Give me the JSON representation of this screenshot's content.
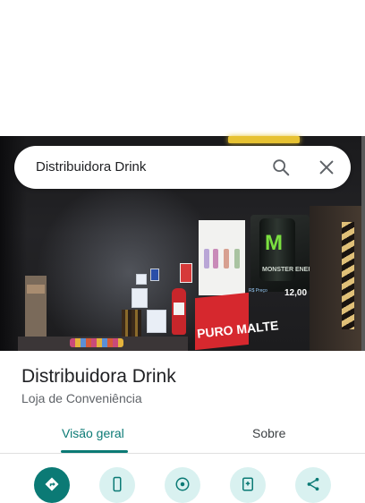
{
  "search": {
    "query": "Distribuidora Drink"
  },
  "place": {
    "name": "Distribuidora Drink",
    "category": "Loja de Conveniência"
  },
  "tabs": [
    {
      "label": "Visão geral",
      "active": true
    },
    {
      "label": "Sobre",
      "active": false
    }
  ],
  "photo_text": {
    "poster": "PURO MALTE",
    "monster": "MONSTER ENERGY",
    "price": "12,00",
    "price_note": "R$ Preço"
  },
  "actions": [
    {
      "icon": "directions-icon"
    },
    {
      "icon": "phone-icon"
    },
    {
      "icon": "website-icon"
    },
    {
      "icon": "save-icon"
    },
    {
      "icon": "share-icon"
    }
  ],
  "colors": {
    "accent": "#0b7a75",
    "action_bg": "#d9f1f0",
    "text_primary": "#202124",
    "text_secondary": "#5f6368"
  }
}
